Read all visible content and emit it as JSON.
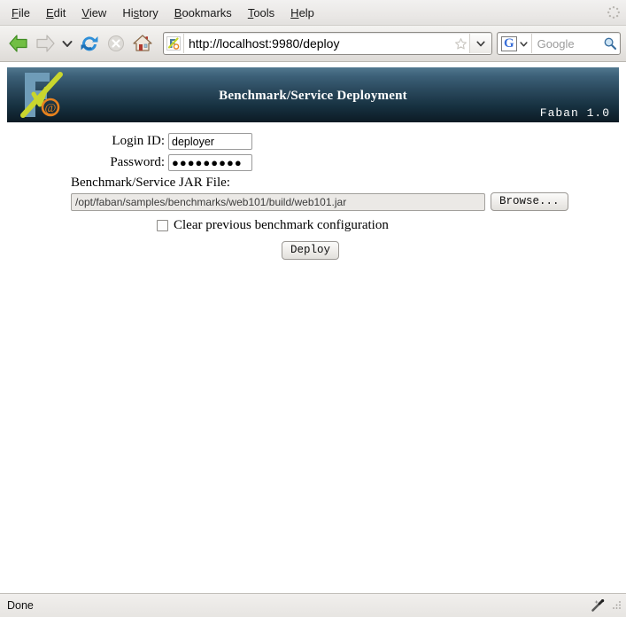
{
  "browser": {
    "menu": [
      {
        "label": "File",
        "accel": "F"
      },
      {
        "label": "Edit",
        "accel": "E"
      },
      {
        "label": "View",
        "accel": "V"
      },
      {
        "label": "History",
        "accel": "s"
      },
      {
        "label": "Bookmarks",
        "accel": "B"
      },
      {
        "label": "Tools",
        "accel": "T"
      },
      {
        "label": "Help",
        "accel": "H"
      }
    ],
    "toolbar": {
      "back": "Back",
      "forward": "Forward",
      "history_dropdown": "Recent pages",
      "reload": "Reload",
      "stop": "Stop",
      "home": "Home"
    },
    "url": {
      "value": "http://localhost:9980/deploy",
      "bookmark": "Bookmark this page",
      "dropdown": "Show history"
    },
    "search": {
      "engine": "G",
      "placeholder": "Google",
      "go": "Search"
    },
    "status": {
      "text": "Done",
      "plugin_icon": "wand-icon",
      "resize_grip": "resize-grip"
    }
  },
  "page": {
    "banner": {
      "title": "Benchmark/Service Deployment",
      "version": "Faban 1.0",
      "logo_alt": "Faban logo",
      "gradient_top": "#51788f",
      "gradient_bottom": "#0c1a24"
    },
    "form": {
      "login_label": "Login ID:",
      "login_value": "deployer",
      "password_label": "Password:",
      "password_value": "●●●●●●●●●",
      "jar_label": "Benchmark/Service JAR File:",
      "jar_value": "/opt/faban/samples/benchmarks/web101/build/web101.jar",
      "browse_label": "Browse...",
      "clear_checkbox_label": "Clear previous benchmark configuration",
      "clear_checkbox_checked": false,
      "deploy_label": "Deploy"
    }
  }
}
